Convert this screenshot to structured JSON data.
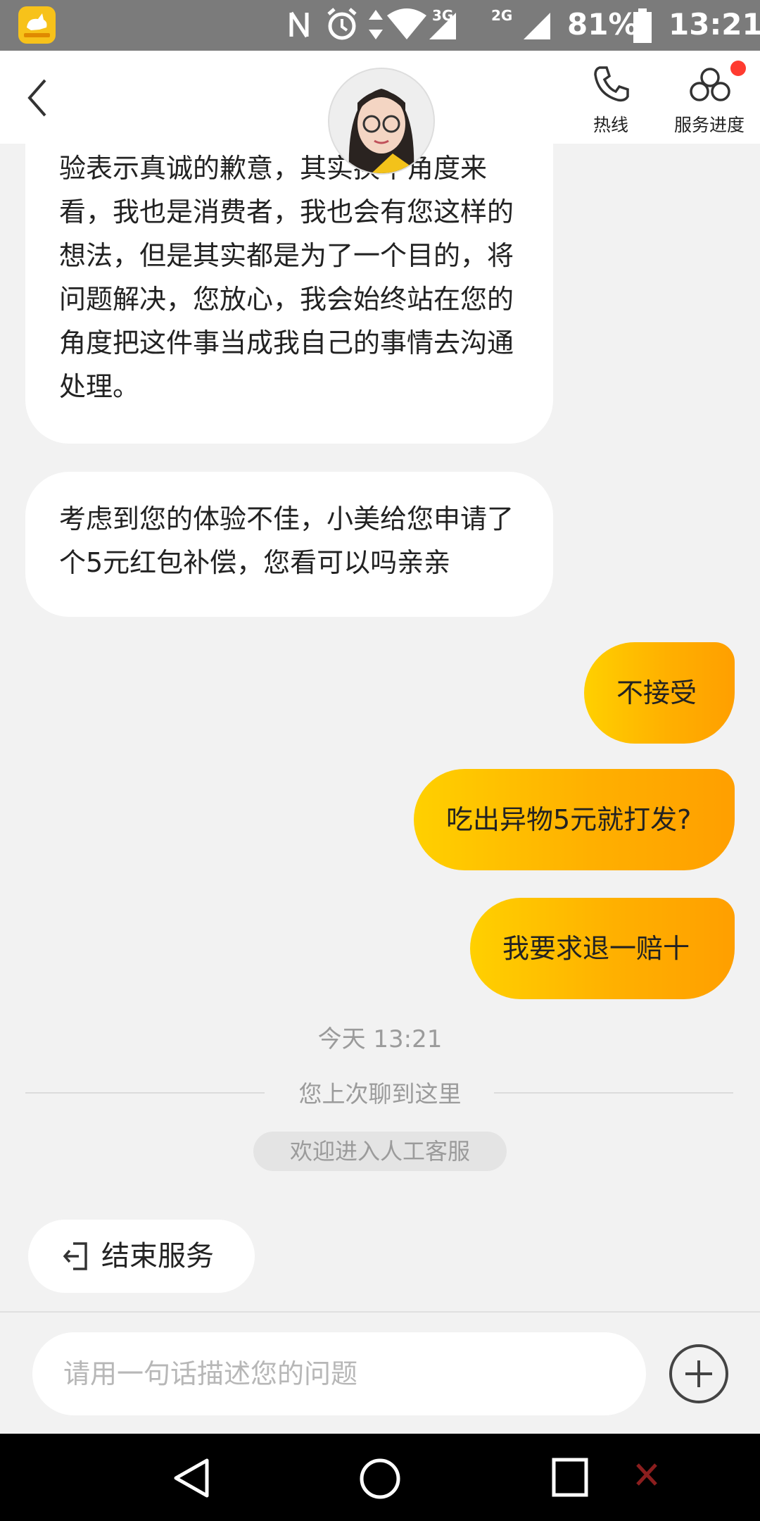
{
  "status_bar": {
    "battery": "81%",
    "time": "13:21",
    "network_3g": "3G",
    "network_2g": "2G"
  },
  "header": {
    "hotline_label": "热线",
    "progress_label": "服务进度"
  },
  "messages": {
    "agent_1": "验表示真诚的歉意，其实换个角度来看，我也是消费者，我也会有您这样的想法，但是其实都是为了一个目的，将问题解决，您放心，我会始终站在您的角度把这件事当成我自己的事情去沟通处理。",
    "agent_2": "考虑到您的体验不佳，小美给您申请了个5元红包补偿，您看可以吗亲亲",
    "user_1": "不接受",
    "user_2": "吃出异物5元就打发?",
    "user_3": "我要求退一赔十"
  },
  "system": {
    "timestamp": "今天 13:21",
    "last_chat": "您上次聊到这里",
    "welcome": "欢迎进入人工客服"
  },
  "end_service": {
    "label": "结束服务"
  },
  "input": {
    "placeholder": "请用一句话描述您的问题"
  },
  "colors": {
    "bubble_gradient_start": "#ffd000",
    "bubble_gradient_end": "#ff9f00",
    "notification_dot": "#ff3b30"
  }
}
